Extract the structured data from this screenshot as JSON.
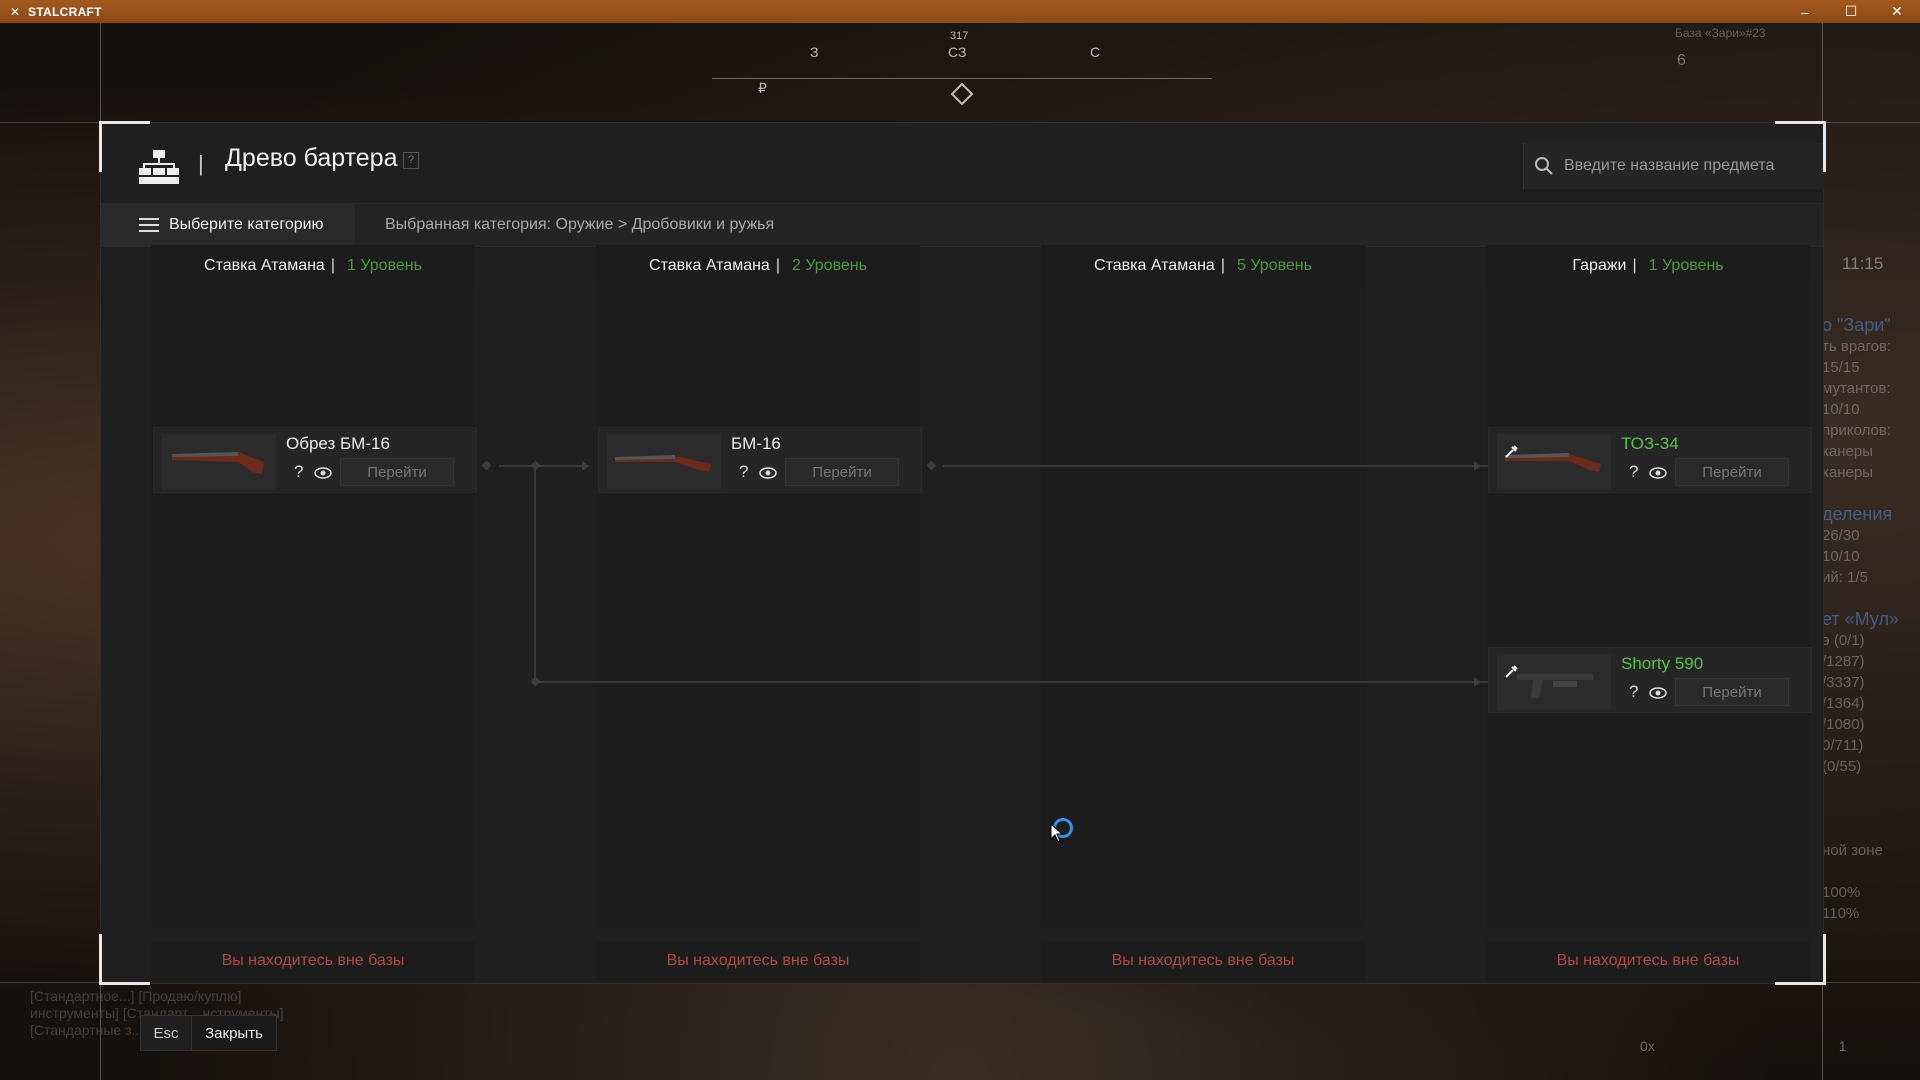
{
  "window": {
    "title": "STALCRAFT",
    "controls": [
      "–",
      "☐",
      "✕"
    ]
  },
  "hud": {
    "compass": {
      "heading": "317",
      "labels": [
        "З",
        "СЗ",
        "С"
      ],
      "marker": "₽"
    },
    "base_label": "База «Зари»#23",
    "base_number": "6",
    "clock": "11:15",
    "quest_lines": [
      "о \"Зари\"",
      "ть врагов:",
      "15/15",
      "мутантов:",
      "10/10",
      "приколов:",
      "канеры",
      "канеры",
      "",
      "деления",
      "26/30",
      "10/10",
      "ий: 1/5",
      "",
      "ет «Мул»",
      "э (0/1)",
      "/1287)",
      "/3337)",
      "/1364)",
      "/1080)",
      "0/711)",
      "(0/55)",
      "",
      "",
      "",
      "ной зоне",
      "",
      "100%",
      "110%"
    ],
    "chat_lines": [
      "[Стандартное...] [Продаю/куплю]",
      "инструменты] [Стандарт... нструменты]",
      "[Стандартные з... вайте в мой отряд]"
    ],
    "bottom_right": "0x",
    "bottom_right_count": "1"
  },
  "panel": {
    "title": "Древо бартера",
    "help": "?",
    "search_placeholder": "Введите название предмета",
    "category_button": "Выберите категорию",
    "category_path": "Выбранная категория: Оружие > Дробовики и ружья",
    "columns": [
      {
        "place": "Ставка Атамана",
        "level": "1 Уровень",
        "footer": "Вы находитесь вне базы"
      },
      {
        "place": "Ставка Атамана",
        "level": "2 Уровень",
        "footer": "Вы находитесь вне базы"
      },
      {
        "place": "Ставка Атамана",
        "level": "5 Уровень",
        "footer": "Вы находитесь вне базы"
      },
      {
        "place": "Гаражи",
        "level": "1 Уровень",
        "footer": "Вы находитесь вне базы"
      }
    ],
    "items": [
      {
        "name": "Обрез БМ-16",
        "help": "?",
        "go": "Перейти"
      },
      {
        "name": "БМ-16",
        "help": "?",
        "go": "Перейти"
      },
      {
        "name": "ТОЗ-34",
        "help": "?",
        "go": "Перейти"
      },
      {
        "name": "Shorty 590",
        "help": "?",
        "go": "Перейти"
      }
    ]
  },
  "footer": {
    "esc_key": "Esc",
    "close_label": "Закрыть"
  },
  "colors": {
    "accent_level": "#4c9a3e",
    "item_highlight": "#59c24a",
    "warning_text": "#b24a44",
    "titlebar": "#a2581e"
  }
}
